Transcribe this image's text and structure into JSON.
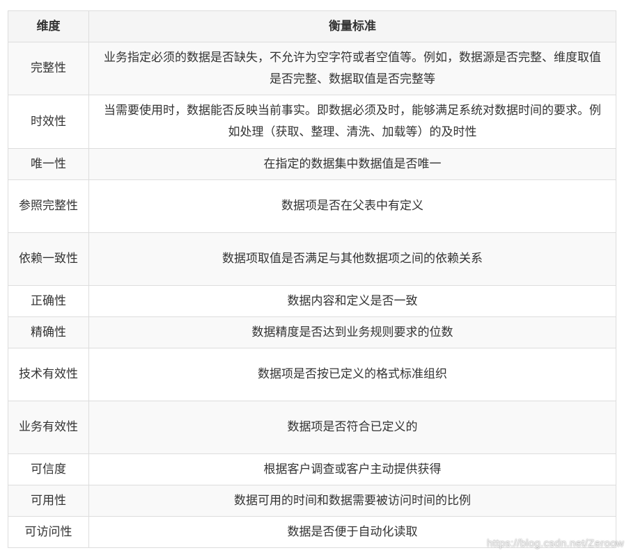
{
  "table": {
    "headers": {
      "dimension": "维度",
      "criterion": "衡量标准"
    },
    "rows": [
      {
        "dimension": "完整性",
        "criterion": "业务指定必须的数据是否缺失，不允许为空字符或者空值等。例如，数据源是否完整、维度取值是否完整、数据取值是否完整等"
      },
      {
        "dimension": "时效性",
        "criterion": "当需要使用时，数据能否反映当前事实。即数据必须及时，能够满足系统对数据时间的要求。例如处理（获取、整理、清洗、加载等）的及时性"
      },
      {
        "dimension": "唯一性",
        "criterion": "在指定的数据集中数据值是否唯一"
      },
      {
        "dimension": "参照完整性",
        "criterion": "数据项是否在父表中有定义"
      },
      {
        "dimension": "依赖一致性",
        "criterion": "数据项取值是否满足与其他数据项之间的依赖关系"
      },
      {
        "dimension": "正确性",
        "criterion": "数据内容和定义是否一致"
      },
      {
        "dimension": "精确性",
        "criterion": "数据精度是否达到业务规则要求的位数"
      },
      {
        "dimension": "技术有效性",
        "criterion": "数据项是否按已定义的格式标准组织"
      },
      {
        "dimension": "业务有效性",
        "criterion": "数据项是否符合已定义的"
      },
      {
        "dimension": "可信度",
        "criterion": "根据客户调查或客户主动提供获得"
      },
      {
        "dimension": "可用性",
        "criterion": "数据可用的时间和数据需要被访问时间的比例"
      },
      {
        "dimension": "可访问性",
        "criterion": "数据是否便于自动化读取"
      }
    ]
  },
  "watermark": "https://blog.csdn.net/Zeroow"
}
